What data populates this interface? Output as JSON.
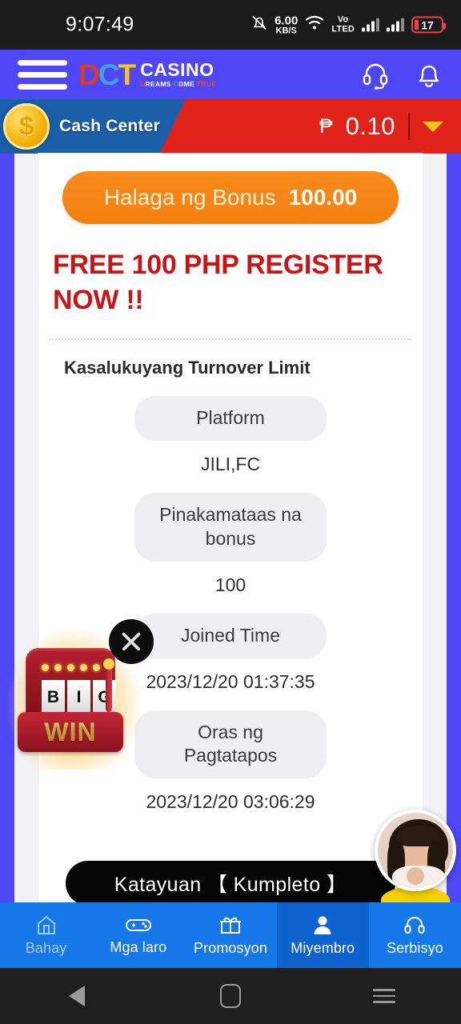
{
  "statusbar": {
    "time": "9:07:49",
    "network_speed": "6.00",
    "network_unit": "KB/S",
    "volte_top": "Vo",
    "volte_bottom": "LTED",
    "battery": "17",
    "icons": [
      "bell-muted-icon",
      "wifi-icon",
      "volte-icon",
      "signal-bars-icon",
      "signal-bars-icon",
      "battery-icon"
    ]
  },
  "header": {
    "menu_icon": "hamburger-menu-icon",
    "logo_d": "D",
    "logo_c": "C",
    "logo_t": "T",
    "logo_casino": "CASINO",
    "logo_sub_1": "D",
    "logo_sub_2": "REAMS ",
    "logo_sub_3": "C",
    "logo_sub_4": "OME ",
    "logo_sub_5": "TRUE",
    "support_icon": "headset-icon",
    "bell_icon": "bell-icon",
    "bg_color": "#4f46f5"
  },
  "cash_center": {
    "coin_symbol": "$",
    "label": "Cash Center",
    "currency": "₱",
    "amount": "0.10",
    "chevron": "chevron-down-icon",
    "left_color": "#1b5fa8",
    "right_color": "#e0221a"
  },
  "card": {
    "bonus_label": "Halaga ng Bonus",
    "bonus_value": "100.00",
    "promo_text": "FREE 100 PHP REGISTER NOW !!",
    "section_title": "Kasalukuyang Turnover Limit",
    "fields": [
      {
        "label": "Platform",
        "value": "JILI,FC"
      },
      {
        "label": "Pinakamataas na bonus",
        "value": "100"
      },
      {
        "label": "Joined Time",
        "value": "2023/12/20 01:37:35"
      },
      {
        "label": "Oras ng Pagtatapos",
        "value": "2023/12/20 03:06:29"
      }
    ],
    "status_text": "Katayuan 【 Kumpleto 】",
    "promo_color": "#c7161a",
    "bonus_pill_color": "#f2800f"
  },
  "overlays": {
    "close_icon": "close-x-icon",
    "bigwin_reel_1": "B",
    "bigwin_reel_2": "I",
    "bigwin_reel_3": "G",
    "bigwin_word": "WIN",
    "avatar": "agent-avatar"
  },
  "bottom_nav": {
    "items": [
      {
        "label": "Bahay",
        "icon": "home-icon"
      },
      {
        "label": "Mga laro",
        "icon": "gamepad-icon"
      },
      {
        "label": "Promosyon",
        "icon": "gift-icon"
      },
      {
        "label": "Miyembro",
        "icon": "person-icon"
      },
      {
        "label": "Serbisyo",
        "icon": "headset-icon"
      }
    ],
    "active_index": 3,
    "bg_color": "#1677e8",
    "active_color": "#0f63cf"
  },
  "android_nav": {
    "back": "back-triangle-icon",
    "home": "home-square-icon",
    "recents": "recents-lines-icon"
  }
}
